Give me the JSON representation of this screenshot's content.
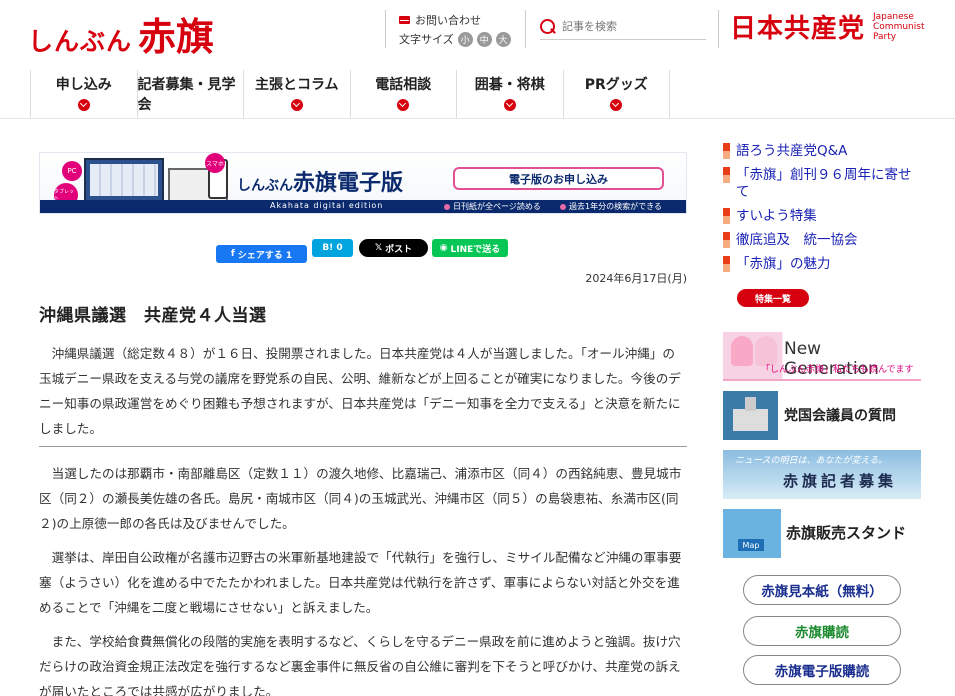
{
  "header": {
    "logo_kana": "しんぶん",
    "logo_kanji": "赤旗",
    "contact": "お問い合わせ",
    "font_size_label": "文字サイズ",
    "font_sizes": [
      "小",
      "中",
      "大"
    ],
    "search_placeholder": "記事を検索",
    "party_name": "日本共産党",
    "party_en": [
      "Japanese",
      "Communist",
      "Party"
    ]
  },
  "nav": {
    "items": [
      {
        "label": "申し込み"
      },
      {
        "label": "記者募集・見学会"
      },
      {
        "label": "主張とコラム"
      },
      {
        "label": "電話相談"
      },
      {
        "label": "囲碁・将棋"
      },
      {
        "label": "PRグッズ"
      }
    ]
  },
  "banner": {
    "title_small": "しんぶん",
    "title_big": "赤旗電子版",
    "subtitle": "Akahata digital edition",
    "button": "電子版のお申し込み",
    "note1": "日刊紙が全ページ読める",
    "note2": "過去1年分の検索ができる",
    "bubble_pc": "PC",
    "bubble_tablet": "タブレット",
    "bubble_phone": "スマホ"
  },
  "share": {
    "facebook": "シェアする 1",
    "hatena": "B! 0",
    "x": "ポスト",
    "line": "LINEで送る"
  },
  "article": {
    "date": "2024年6月17日(月)",
    "headline": "沖縄県議選　共産党４人当選",
    "lead": "沖縄県議選（総定数４８）が１６日、投開票されました。日本共産党は４人が当選しました。「オール沖縄」の玉城デニー県政を支える与党の議席を野党系の自民、公明、維新などが上回ることが確実になりました。今後のデニー知事の県政運営をめぐり困難も予想されますが、日本共産党は「デニー知事を全力で支える」と決意を新たにしました。",
    "p1": "当選したのは那覇市・南部離島区（定数１１）の渡久地修、比嘉瑞己、浦添市区（同４）の西銘純恵、豊見城市区（同２）の瀬長美佐雄の各氏。島尻・南城市区（同４)の玉城武光、沖縄市区（同５）の島袋恵祐、糸満市区(同２)の上原徳一郎の各氏は及びませんでした。",
    "p2": "選挙は、岸田自公政権が名護市辺野古の米軍新基地建設で「代執行」を強行し、ミサイル配備など沖縄の軍事要塞（ようさい）化を進める中でたたかわれました。日本共産党は代執行を許さず、軍事によらない対話と外交を進めることで「沖縄を二度と戦場にさせない」と訴えました。",
    "p3": "また、学校給食費無償化の段階的実施を表明するなど、くらしを守るデニー県政を前に進めようと強調。抜け穴だらけの政治資金規正法改定を強行するなど裏金事件に無反省の自公維に審判を下そうと呼びかけ、共産党の訴えが届いたところでは共感が広がりました。"
  },
  "sidebar": {
    "links": [
      {
        "label": "語ろう共産党Q&A"
      },
      {
        "label": "「赤旗」創刊９６周年に寄せて"
      },
      {
        "label": "すいよう特集"
      },
      {
        "label": "徹底追及　統一協会"
      },
      {
        "label": "「赤旗」の魅力"
      }
    ],
    "special_list": "特集一覧",
    "banners": {
      "new_generation": "New Generation",
      "new_generation_sub": "「しんぶん赤旗」私たちも読んでます",
      "diet_questions": "党国会議員の質問",
      "reporter_top": "ニュースの明日は、あなたが変える。",
      "reporter": "赤旗記者募集",
      "stand_map": "Map",
      "stand": "赤旗販売スタンド"
    },
    "buttons": {
      "sample": "赤旗見本紙（無料）",
      "subscribe": "赤旗購読",
      "digital": "赤旗電子版購読"
    }
  },
  "colors": {
    "brand_red": "#d7000f",
    "link_blue": "#1a22b5",
    "navy": "#0b2a6e"
  }
}
